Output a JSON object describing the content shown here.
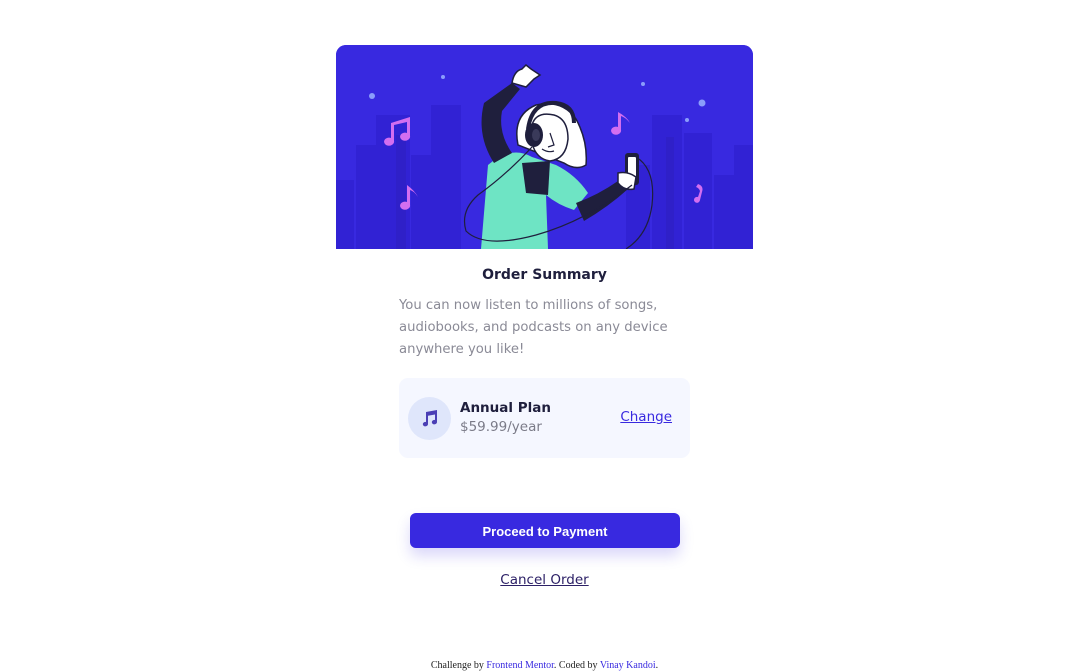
{
  "hero": {
    "background_color": "#3829e0",
    "illustration": "illustration-dancing-person-with-headphones"
  },
  "card": {
    "title": "Order Summary",
    "description": "You can now listen to millions of songs, audiobooks, and podcasts on any device anywhere you like!",
    "plan": {
      "icon": "music-note-icon",
      "name": "Annual Plan",
      "price": "$59.99/year",
      "change_label": "Change"
    },
    "proceed_label": "Proceed to Payment",
    "cancel_label": "Cancel Order"
  },
  "footer": {
    "prefix": "Challenge by",
    "challenge_link": "Frontend Mentor",
    "middle": ". Coded by",
    "author_link": "Vinay Kandoi",
    "suffix": "."
  },
  "colors": {
    "accent": "#3829e0",
    "plan_bg": "#f5f7ff",
    "icon_bg": "#dfe6fb"
  }
}
